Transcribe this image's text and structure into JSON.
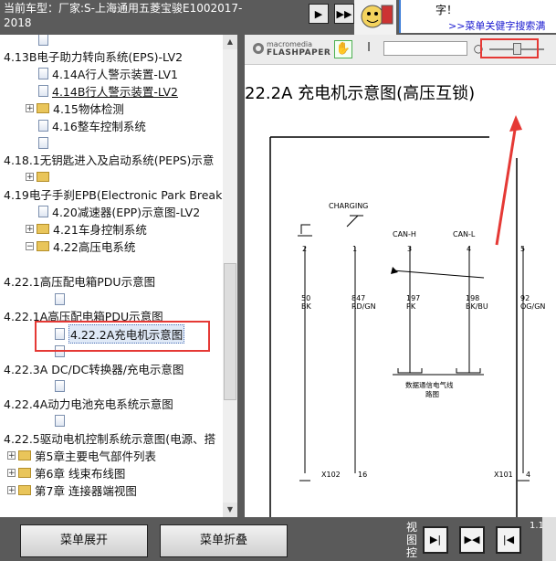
{
  "header": {
    "car_line1": "当前车型：厂家:S-上海通用五菱宝骏E1002017-",
    "car_line2": "2018",
    "nav_btn1": "▶",
    "nav_btn2": "▶▶",
    "ad_text1": "字！",
    "ad_text2": ">>菜单关健字搜索满"
  },
  "tree": {
    "items": [
      {
        "label": ""
      },
      {
        "label": "4.13B电子助力转向系统(EPS)-LV2"
      },
      {
        "label": "4.14A行人警示装置-LV1"
      },
      {
        "label": "4.14B行人警示装置-LV2"
      },
      {
        "label": "4.15物体检测"
      },
      {
        "label": "4.16整车控制系统"
      },
      {
        "label": ""
      },
      {
        "label": "4.18.1无钥匙进入及启动系统(PEPS)示意"
      },
      {
        "label": ""
      },
      {
        "label": "4.19电子手刹EPB(Electronic Park Break"
      },
      {
        "label": "4.20减速器(EPP)示意图-LV2"
      },
      {
        "label": "4.21车身控制系统"
      },
      {
        "label": "4.22高压电系统"
      },
      {
        "label": "4.22.1高压配电箱PDU示意图"
      },
      {
        "label": ""
      },
      {
        "label": "4.22.1A高压配电箱PDU示意图"
      },
      {
        "label": "4.22.2A充电机示意图"
      },
      {
        "label": ""
      },
      {
        "label": "4.22.3A DC/DC转换器/充电示意图"
      },
      {
        "label": ""
      },
      {
        "label": "4.22.4A动力电池充电系统示意图"
      },
      {
        "label": ""
      },
      {
        "label": "4.22.5驱动电机控制系统示意图(电源、搭"
      },
      {
        "label": "第5章主要电气部件列表"
      },
      {
        "label": "第6章 线束布线图"
      },
      {
        "label": "第7章 连接器端视图"
      }
    ]
  },
  "flashpaper": {
    "logo_line1": "macromedia",
    "logo_line2": "FLASHPAPER",
    "hand_tool": "✋",
    "text_tool": "I",
    "search_icon": "○"
  },
  "diagram": {
    "title": "22.2A 充电机示意图(高压互锁)",
    "charging_label": "CHARGING",
    "can_h": "CAN-H",
    "can_l": "CAN-L",
    "pin2": "2",
    "pin1": "1",
    "pin3": "3",
    "pin4": "4",
    "pin5": "5",
    "w1a": "50",
    "w1b": "BK",
    "w2a": "847",
    "w2b": "RD/GN",
    "w3a": "197",
    "w3b": "PK",
    "w4a": "198",
    "w4b": "BK/BU",
    "w5a": "92",
    "w5b": "OG/GN",
    "note1": "数据通信电气线",
    "note2": "路图",
    "x102": "X102",
    "x102_pin": "16",
    "x101": "X101",
    "x101_pin": "4"
  },
  "bottom": {
    "expand_label": "菜单展开",
    "collapse_label": "菜单折叠",
    "view_label": "视图控",
    "view_btn1": "▶|",
    "view_btn2": "▶◀",
    "view_btn3": "|◀",
    "page": "1.1|"
  },
  "colors": {
    "highlight": "#e53935",
    "link": "#1a1ad0"
  }
}
